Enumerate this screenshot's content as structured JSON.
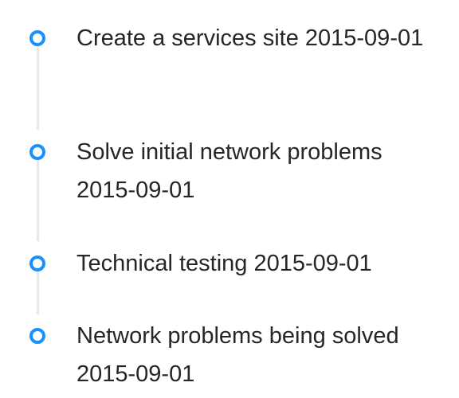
{
  "timeline": {
    "accent_color": "#1890ff",
    "items": [
      {
        "text": "Create a services site 2015-09-01"
      },
      {
        "text": "Solve initial network problems 2015-09-01"
      },
      {
        "text": "Technical testing 2015-09-01"
      },
      {
        "text": "Network problems being solved 2015-09-01"
      }
    ]
  }
}
